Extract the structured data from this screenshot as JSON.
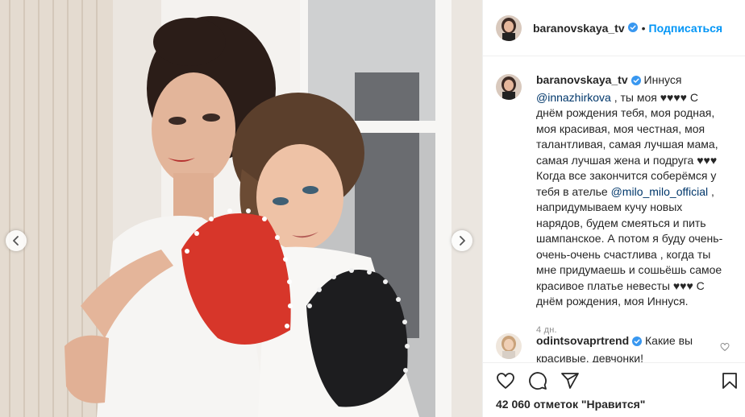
{
  "post": {
    "username": "baranovskaya_tv",
    "follow_label": "Подписаться",
    "dot": "•"
  },
  "caption": {
    "username": "baranovskaya_tv",
    "text_1": "Иннуся",
    "mention_1": "@innazhirkova",
    "text_2": ", ты моя ♥♥♥♥ С днём рождения тебя, моя родная, моя красивая, моя честная, моя талантливая, самая лучшая мама, самая лучшая жена и подруга ♥♥♥ Когда все закончится соберёмся у тебя в ателье",
    "mention_2": "@milo_milo_official",
    "text_3": ", напридумываем кучу новых нарядов, будем смеяться и пить шампанское. А потом я буду очень-очень-очень счастлива , когда ты мне придумаешь и сошьёшь самое красивое платье невесты ♥♥♥ С днём рождения, моя Иннуся.",
    "time": "4 дн."
  },
  "comment": {
    "username": "odintsovaprtrend",
    "text": "Какие вы красивые, девчонки!"
  },
  "likes": {
    "label": "42 060 отметок \"Нравится\""
  },
  "icons": {
    "like": "heart-icon",
    "comment": "comment-icon",
    "share": "share-icon",
    "save": "bookmark-icon",
    "prev": "chevron-left-icon",
    "next": "chevron-right-icon",
    "verified": "verified-badge-icon"
  },
  "colors": {
    "link": "#0095f6",
    "mention": "#00376b",
    "verified": "#3897f0",
    "secondary": "#8e8e8e"
  }
}
